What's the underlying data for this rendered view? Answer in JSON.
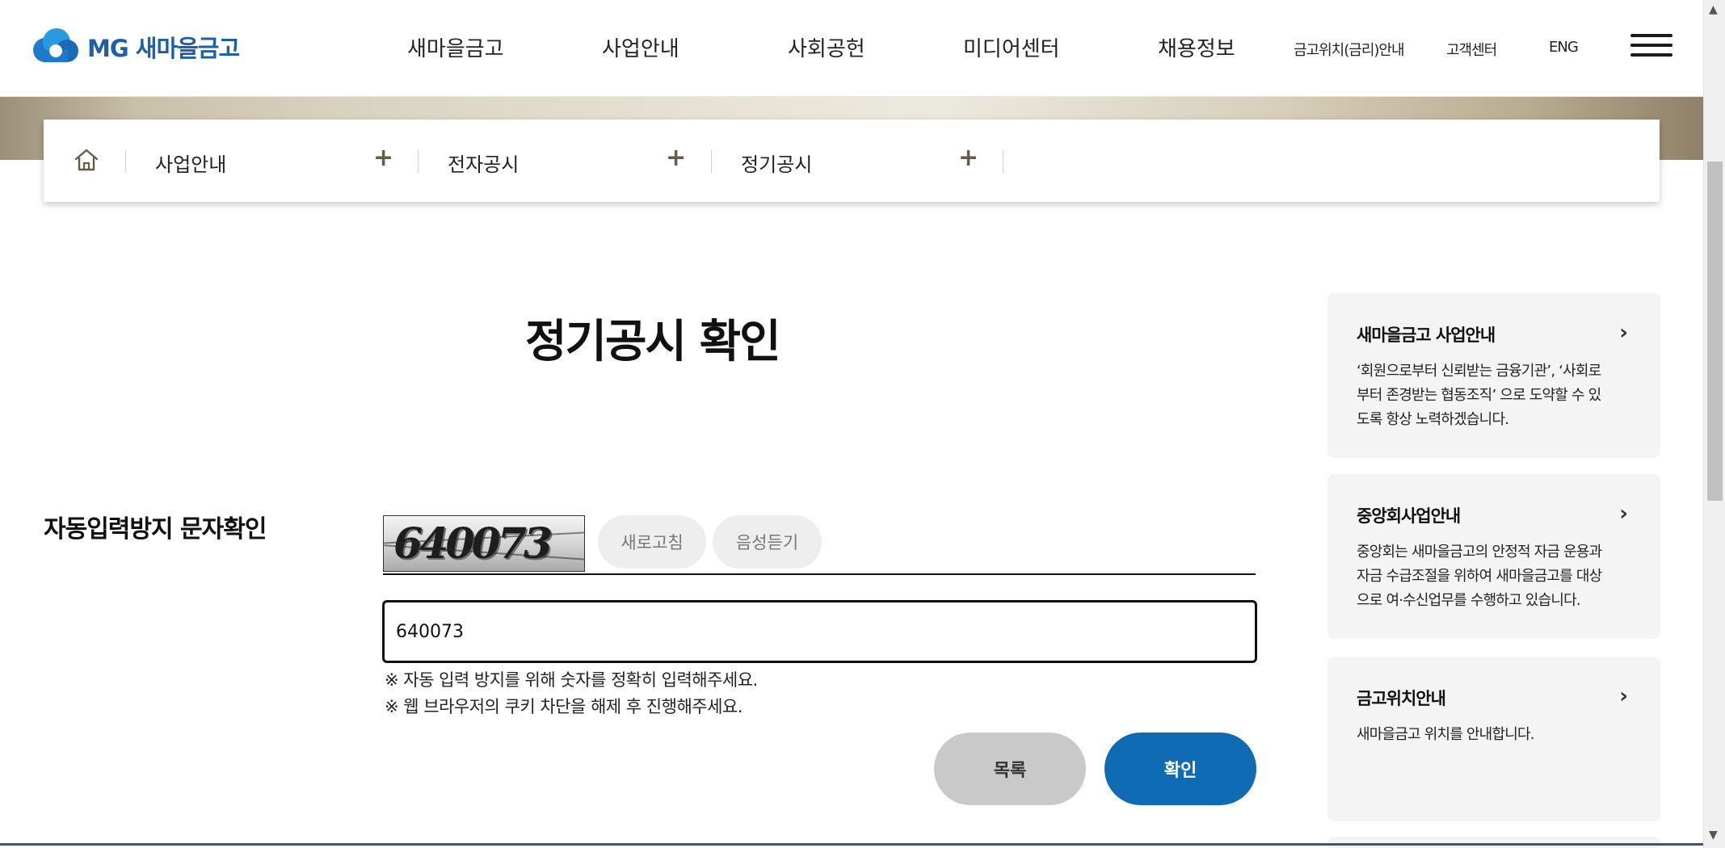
{
  "header": {
    "logo_text": "MG 새마을금고",
    "nav": [
      "새마을금고",
      "사업안내",
      "사회공헌",
      "미디어센터",
      "채용정보"
    ],
    "util": [
      "금고위치(금리)안내",
      "고객센터",
      "ENG"
    ],
    "menu_icon": "hamburger-menu-icon"
  },
  "breadcrumb": {
    "home_icon": "home-icon",
    "items": [
      "사업안내",
      "전자공시",
      "정기공시"
    ],
    "expand_symbol": "+"
  },
  "main": {
    "title": "정기공시 확인",
    "captcha_label": "자동입력방지 문자확인",
    "captcha_image_text": "640073",
    "refresh_label": "새로고침",
    "audio_label": "음성듣기",
    "input_value": "640073",
    "notices": [
      "※ 자동 입력 방지를 위해 숫자를 정확히 입력해주세요.",
      "※ 웹 브라우저의 쿠키 차단을 해제 후 진행해주세요."
    ],
    "list_button": "목록",
    "confirm_button": "확인"
  },
  "side": {
    "cards": [
      {
        "title": "새마을금고 사업안내",
        "desc": [
          "‘회원으로부터 신뢰받는 금융기관’, ‘사회로",
          "부터 존경받는 협동조직’ 으로 도약할 수 있",
          "도록 항상 노력하겠습니다."
        ]
      },
      {
        "title": "중앙회사업안내",
        "desc": [
          "중앙회는 새마을금고의 안정적 자금 운용과",
          "자금 수급조절을 위하여 새마을금고를 대상",
          "으로 여·수신업무를 수행하고 있습니다."
        ]
      },
      {
        "title": "금고위치안내",
        "desc": [
          "새마을금고 위치를 안내합니다."
        ]
      }
    ],
    "arrow_symbol": "›"
  },
  "colors": {
    "brand_blue": "#1d5fa8",
    "confirm_blue": "#0e6bb4",
    "list_gray": "#c9c9c9",
    "crumb_plus": "#6a5a44"
  }
}
